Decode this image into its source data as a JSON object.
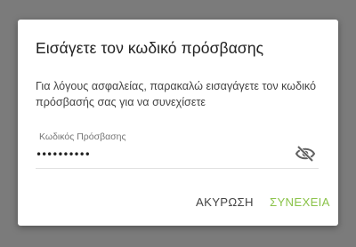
{
  "dialog": {
    "title": "Εισάγετε τον κωδικό πρόσβασης",
    "message": "Για λόγους ασφαλείας, παρακαλώ εισαγάγετε τον κωδικό πρόσβασής σας για να συνεχίσετε",
    "password_field": {
      "label": "Κωδικός Πρόσβασης",
      "value": "••••••••••",
      "toggle_icon": "eye-off-icon"
    },
    "actions": {
      "cancel_label": "ΑΚΥΡΩΣΗ",
      "continue_label": "ΣΥΝΕΧΕΙΑ"
    }
  },
  "colors": {
    "backdrop": "#7b7b7b",
    "dialog_bg": "#ffffff",
    "accent": "#8bc34a",
    "text_primary": "#212121",
    "text_secondary": "#444444"
  }
}
